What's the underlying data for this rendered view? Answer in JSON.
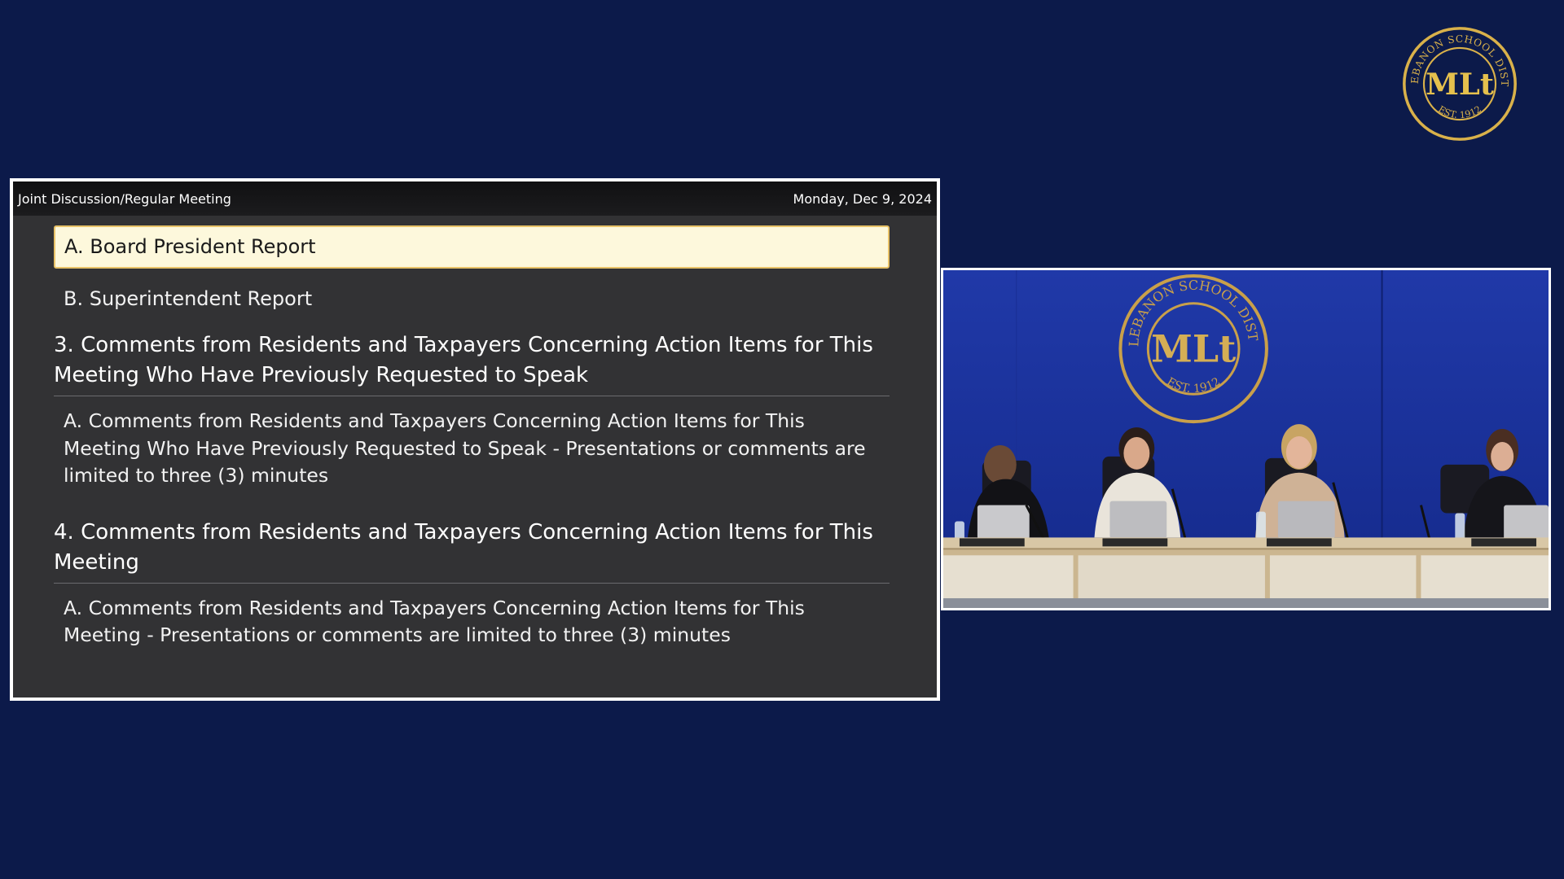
{
  "logo": {
    "icon": "district-seal-icon",
    "ring_text": "MT. LEBANON SCHOOL DISTRICT",
    "monogram": "MLt",
    "established": "EST. 1912",
    "colors": {
      "gold": "#d9b14a",
      "navy": "#0c1a4a"
    }
  },
  "agenda": {
    "header": {
      "meeting_title": "Joint Discussion/Regular Meeting",
      "date": "Monday, Dec 9, 2024"
    },
    "items": [
      {
        "type": "sub",
        "active": true,
        "text": "A. Board President Report"
      },
      {
        "type": "sub",
        "active": false,
        "text": "B. Superintendent Report"
      },
      {
        "type": "section",
        "text": "3. Comments from Residents and Taxpayers Concerning Action Items for This Meeting Who Have Previously Requested to Speak"
      },
      {
        "type": "sub",
        "active": false,
        "text": "A. Comments from Residents and Taxpayers Concerning Action Items for This Meeting Who Have Previously Requested to Speak - Presentations or comments are limited to three (3) minutes"
      },
      {
        "type": "section",
        "text": "4. Comments from Residents and Taxpayers Concerning Action Items for This Meeting"
      },
      {
        "type": "sub",
        "active": false,
        "text": "A. Comments from Residents and Taxpayers Concerning Action Items for This Meeting - Presentations or comments are limited to three (3) minutes"
      }
    ],
    "colors": {
      "panel_bg": "#323234",
      "active_bg": "#fdf8dc",
      "active_border": "#e8c268"
    }
  },
  "video": {
    "icon": "meeting-video-feed",
    "wall_seal_ring_text": "MT. LEBANON SCHOOL DISTRICT",
    "wall_seal_monogram": "MLt",
    "wall_seal_established": "EST. 1912"
  }
}
